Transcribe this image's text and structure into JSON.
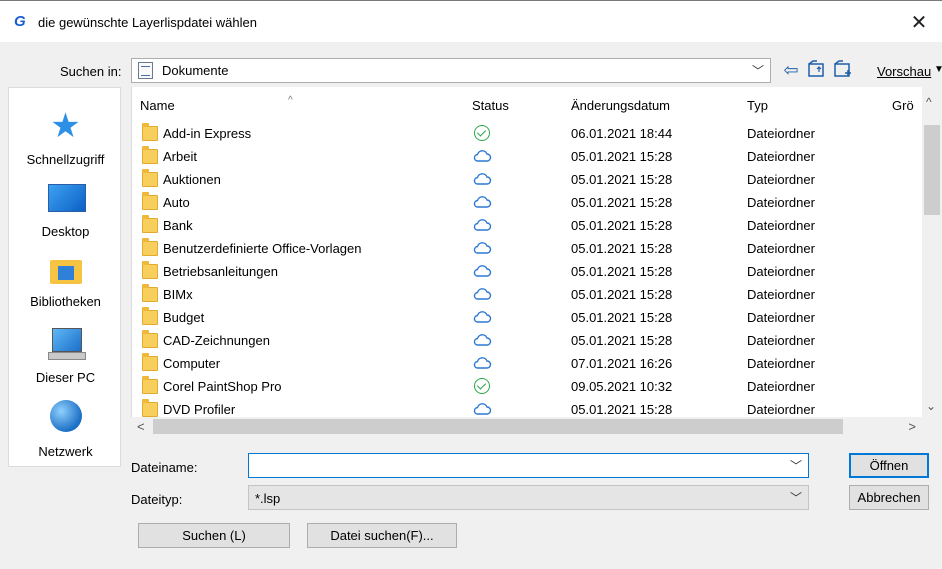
{
  "window": {
    "title": "die gewünschte Layerlispdatei wählen",
    "app_icon": "G",
    "close_glyph": "✕"
  },
  "toolbar": {
    "look_in_label": "Suchen in:",
    "look_in_value": "Dokumente",
    "view_label": "Vorschau",
    "icons": [
      "back-arrow-icon",
      "up-folder-icon",
      "new-folder-icon"
    ]
  },
  "places": [
    {
      "label": "Schnellzugriff",
      "icon": "star-icon"
    },
    {
      "label": "Desktop",
      "icon": "desktop-icon"
    },
    {
      "label": "Bibliotheken",
      "icon": "library-icon"
    },
    {
      "label": "Dieser PC",
      "icon": "computer-icon"
    },
    {
      "label": "Netzwerk",
      "icon": "network-icon"
    }
  ],
  "columns": {
    "name": "Name",
    "status": "Status",
    "date": "Änderungsdatum",
    "type": "Typ",
    "size": "Grö"
  },
  "rows": [
    {
      "name": "Add-in Express",
      "status": "ok",
      "date": "06.01.2021 18:44",
      "type": "Dateiordner"
    },
    {
      "name": "Arbeit",
      "status": "cloud",
      "date": "05.01.2021 15:28",
      "type": "Dateiordner"
    },
    {
      "name": "Auktionen",
      "status": "cloud",
      "date": "05.01.2021 15:28",
      "type": "Dateiordner"
    },
    {
      "name": "Auto",
      "status": "cloud",
      "date": "05.01.2021 15:28",
      "type": "Dateiordner"
    },
    {
      "name": "Bank",
      "status": "cloud",
      "date": "05.01.2021 15:28",
      "type": "Dateiordner"
    },
    {
      "name": "Benutzerdefinierte Office-Vorlagen",
      "status": "cloud",
      "date": "05.01.2021 15:28",
      "type": "Dateiordner"
    },
    {
      "name": "Betriebsanleitungen",
      "status": "cloud",
      "date": "05.01.2021 15:28",
      "type": "Dateiordner"
    },
    {
      "name": "BIMx",
      "status": "cloud",
      "date": "05.01.2021 15:28",
      "type": "Dateiordner"
    },
    {
      "name": "Budget",
      "status": "cloud",
      "date": "05.01.2021 15:28",
      "type": "Dateiordner"
    },
    {
      "name": "CAD-Zeichnungen",
      "status": "cloud",
      "date": "05.01.2021 15:28",
      "type": "Dateiordner"
    },
    {
      "name": "Computer",
      "status": "cloud",
      "date": "07.01.2021 16:26",
      "type": "Dateiordner"
    },
    {
      "name": "Corel PaintShop Pro",
      "status": "ok",
      "date": "09.05.2021 10:32",
      "type": "Dateiordner"
    },
    {
      "name": "DVD Profiler",
      "status": "cloud",
      "date": "05.01.2021 15:28",
      "type": "Dateiordner"
    }
  ],
  "filename": {
    "label": "Dateiname:",
    "value": "",
    "placeholder": ""
  },
  "filetype": {
    "label": "Dateityp:",
    "value": "*.lsp"
  },
  "buttons": {
    "open": "Öffnen",
    "cancel": "Abbrechen",
    "search": "Suchen (L)",
    "find_file": "Datei suchen(F)..."
  },
  "colors": {
    "accent": "#0078d7",
    "folder": "#f8cf5c",
    "status_ok": "#2aa84a",
    "status_cloud": "#2b78d4"
  }
}
